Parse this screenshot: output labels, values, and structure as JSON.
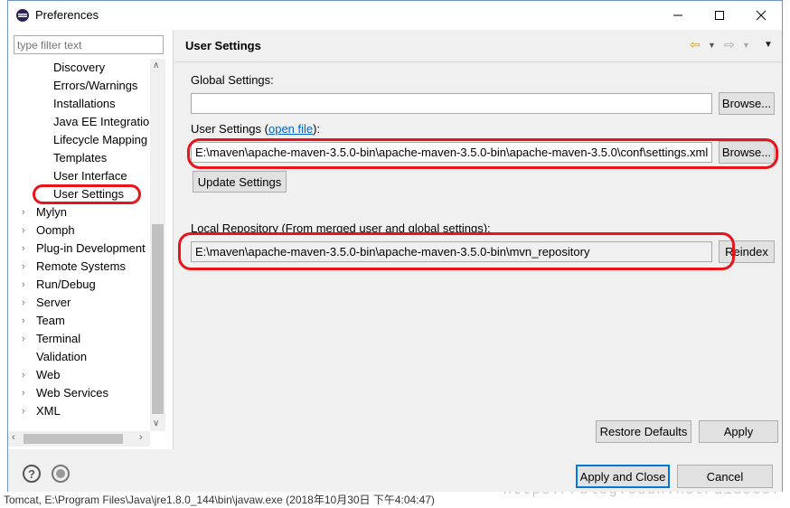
{
  "window": {
    "title": "Preferences"
  },
  "filter": {
    "placeholder": "type filter text"
  },
  "tree": {
    "children": [
      "Discovery",
      "Errors/Warnings",
      "Installations",
      "Java EE Integration",
      "Lifecycle Mapping",
      "Templates",
      "User Interface",
      "User Settings"
    ],
    "roots": [
      "Mylyn",
      "Oomph",
      "Plug-in Development",
      "Remote Systems",
      "Run/Debug",
      "Server",
      "Team",
      "Terminal",
      "Validation",
      "Web",
      "Web Services",
      "XML"
    ]
  },
  "page": {
    "title": "User Settings",
    "global_settings_label": "Global Settings:",
    "global_settings_value": "",
    "user_settings_label": "User Settings (",
    "open_file_link": "open file",
    "user_settings_label_end": "):",
    "user_settings_value": "E:\\maven\\apache-maven-3.5.0-bin\\apache-maven-3.5.0-bin\\apache-maven-3.5.0\\conf\\settings.xml",
    "update_settings": "Update Settings",
    "local_repo_label": "Local Repository (From merged user and global settings):",
    "local_repo_value": "E:\\maven\\apache-maven-3.5.0-bin\\apache-maven-3.5.0-bin\\mvn_repository",
    "browse": "Browse...",
    "reindex": "Reindex",
    "restore_defaults": "Restore Defaults",
    "apply": "Apply"
  },
  "footer": {
    "apply_and_close": "Apply and Close",
    "cancel": "Cancel"
  },
  "background": {
    "status_text": "Tomcat, E:\\Program Files\\Java\\jre1.8.0_144\\bin\\javaw.exe (2018年10月30日 下午4:04:47)",
    "watermark": "https://blog.csdn.net/u139657"
  },
  "colors": {
    "highlight_ring": "#e8141c",
    "link": "#0066cc",
    "primary_border": "#0078d7"
  }
}
